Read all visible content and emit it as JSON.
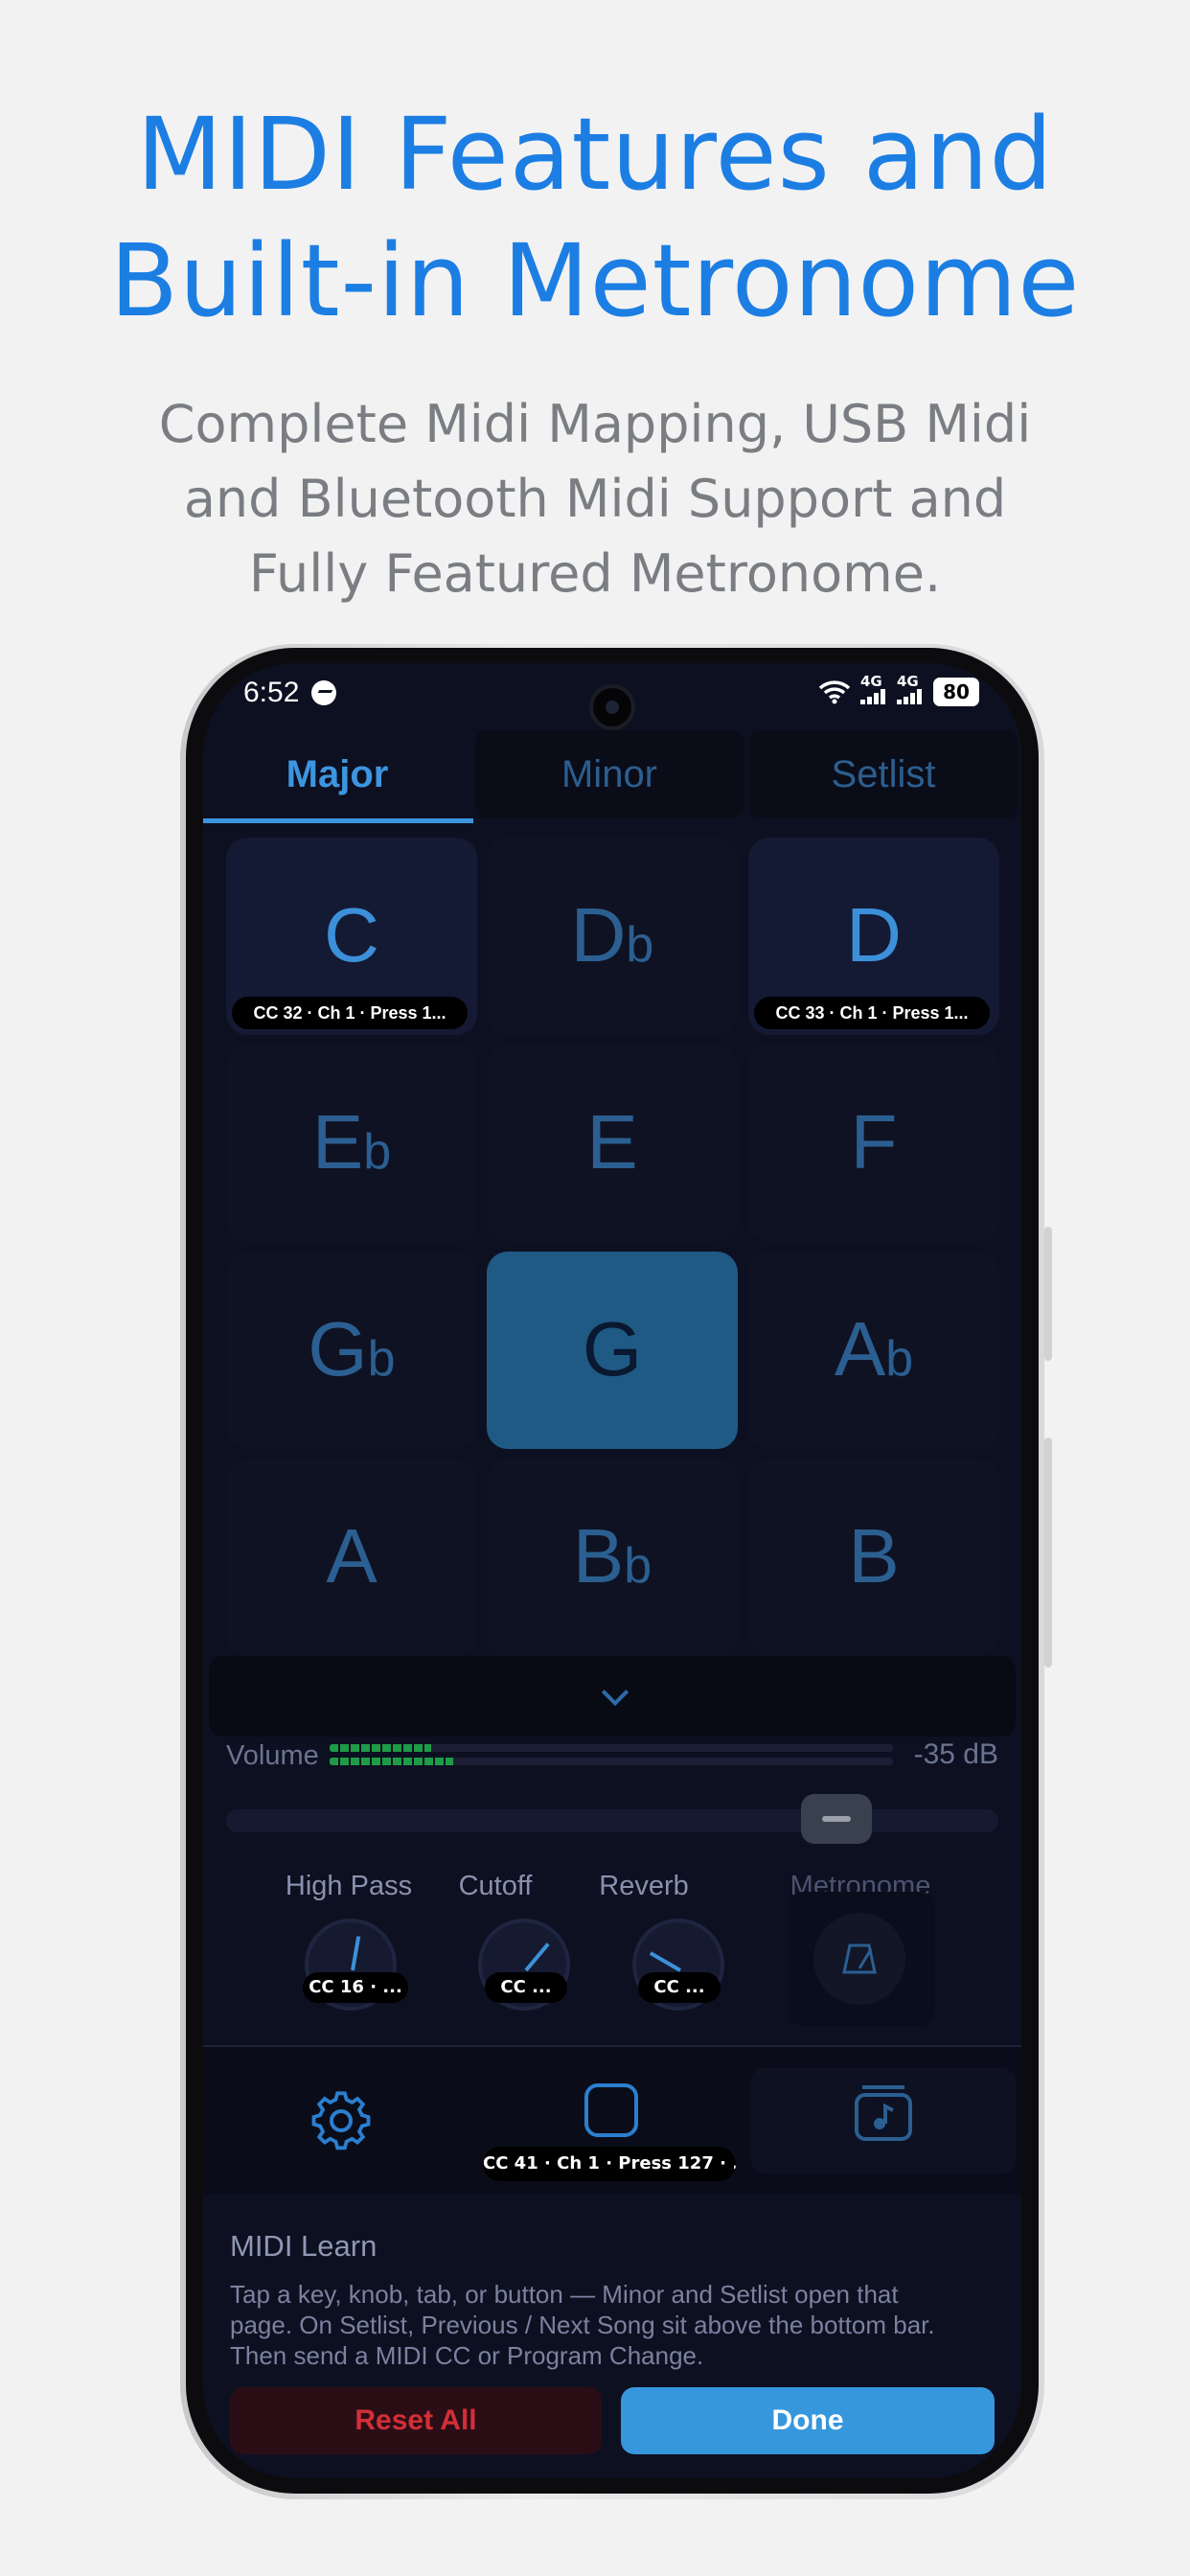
{
  "promo": {
    "headline_line1": "MIDI Features and",
    "headline_line2": "Built-in Metronome",
    "sub_line1": "Complete Midi Mapping, USB Midi",
    "sub_line2": "and Bluetooth Midi Support and",
    "sub_line3": "Fully Featured Metronome."
  },
  "status": {
    "time": "6:52",
    "net1": "4G",
    "net2": "4G",
    "battery": "80"
  },
  "tabs": [
    {
      "label": "Major",
      "active": true
    },
    {
      "label": "Minor",
      "active": false
    },
    {
      "label": "Setlist",
      "active": false
    }
  ],
  "keys": [
    {
      "note": "C",
      "acc": "",
      "cc": "CC 32 · Ch 1 · Press 1..."
    },
    {
      "note": "D",
      "acc": "b",
      "cc": ""
    },
    {
      "note": "D",
      "acc": "",
      "cc": "CC 33 · Ch 1 · Press 1..."
    },
    {
      "note": "E",
      "acc": "b",
      "cc": ""
    },
    {
      "note": "E",
      "acc": "",
      "cc": ""
    },
    {
      "note": "F",
      "acc": "",
      "cc": ""
    },
    {
      "note": "G",
      "acc": "b",
      "cc": ""
    },
    {
      "note": "G",
      "acc": "",
      "cc": ""
    },
    {
      "note": "A",
      "acc": "b",
      "cc": ""
    },
    {
      "note": "A",
      "acc": "",
      "cc": ""
    },
    {
      "note": "B",
      "acc": "b",
      "cc": ""
    },
    {
      "note": "B",
      "acc": "",
      "cc": ""
    }
  ],
  "selected_key": "G",
  "volume": {
    "label": "Volume",
    "db": "-35 dB",
    "meter_levels": [
      0.18,
      0.22
    ],
    "slider_value": 0.78
  },
  "controls": [
    {
      "label": "High Pass",
      "cc": "CC 16 · ..."
    },
    {
      "label": "Cutoff",
      "cc": "CC ..."
    },
    {
      "label": "Reverb",
      "cc": "CC ..."
    },
    {
      "label": "Metronome",
      "cc": ""
    }
  ],
  "bottom_bar": {
    "settings_icon": "gear-icon",
    "center_icon": "stop-square-icon",
    "center_cc": "CC 41 · Ch 1 · Press 127 · ...",
    "setlist_icon": "music-folder-icon"
  },
  "midi_learn": {
    "title": "MIDI Learn",
    "desc_line1": "Tap a key, knob, tab, or button — Minor and Setlist open that",
    "desc_line2": "page. On Setlist, Previous / Next Song sit above the bottom bar.",
    "desc_line3": "Then send a MIDI CC or Program Change.",
    "reset_label": "Reset All",
    "done_label": "Done"
  },
  "colors": {
    "accent": "#3d95df",
    "promo_title": "#1c7ee3",
    "danger": "#d22f36",
    "meter": "#1e9b47"
  }
}
